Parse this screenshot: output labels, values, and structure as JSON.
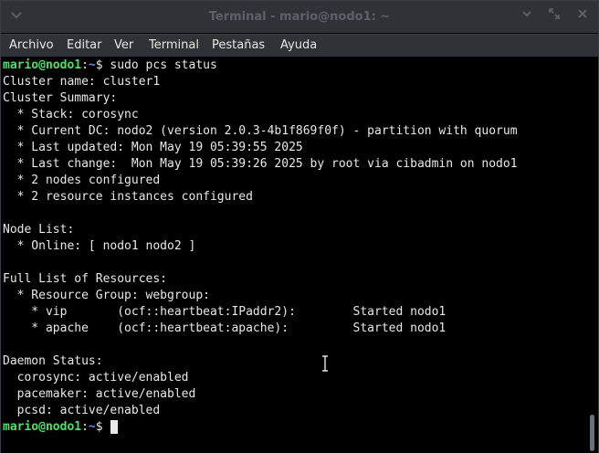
{
  "window": {
    "title": "Terminal - mario@nodo1: ~"
  },
  "menu": [
    "Archivo",
    "Editar",
    "Ver",
    "Terminal",
    "Pestañas",
    "Ayuda"
  ],
  "prompt": {
    "user_host": "mario@nodo1",
    "sep": ":",
    "path": "~",
    "symbol": "$"
  },
  "command": " sudo pcs status",
  "output": [
    "Cluster name: cluster1",
    "Cluster Summary:",
    "  * Stack: corosync",
    "  * Current DC: nodo2 (version 2.0.3-4b1f869f0f) - partition with quorum",
    "  * Last updated: Mon May 19 05:39:55 2025",
    "  * Last change:  Mon May 19 05:39:26 2025 by root via cibadmin on nodo1",
    "  * 2 nodes configured",
    "  * 2 resource instances configured",
    "",
    "Node List:",
    "  * Online: [ nodo1 nodo2 ]",
    "",
    "Full List of Resources:",
    "  * Resource Group: webgroup:",
    "    * vip       (ocf::heartbeat:IPaddr2):        Started nodo1",
    "    * apache    (ocf::heartbeat:apache):         Started nodo1",
    "",
    "Daemon Status:",
    "  corosync: active/enabled",
    "  pacemaker: active/enabled",
    "  pcsd: active/enabled"
  ],
  "colors": {
    "prompt_user": "#4ee06a",
    "prompt_path": "#6a8cff",
    "background": "#000000",
    "text": "#e8e8e8"
  },
  "icons": {
    "menu": "chevron-down-icon",
    "minimize": "minimize-icon",
    "maximize": "maximize-icon",
    "close": "close-icon"
  }
}
